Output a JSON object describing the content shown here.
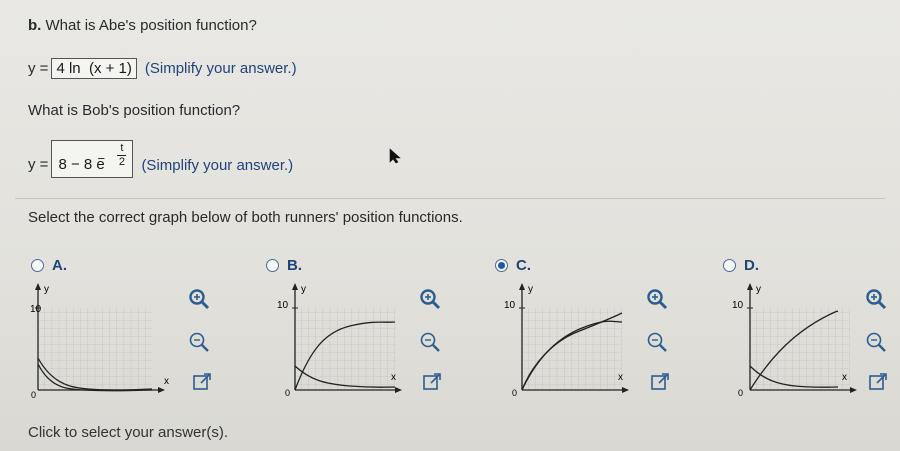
{
  "question_b": {
    "label": "b.",
    "text": "What is Abe's position function?",
    "lhs": "y =",
    "answer": "4 ln  (x + 1)",
    "hint": "(Simplify your answer.)"
  },
  "question_bob": {
    "text": "What is Bob's position function?",
    "lhs": "y =",
    "answer_base": "8 − 8 e",
    "answer_exp_minus": "−",
    "answer_exp_num": "t",
    "answer_exp_den": "2",
    "hint": "(Simplify your answer.)"
  },
  "select_prompt": "Select the correct graph below of both runners' position functions.",
  "options": [
    {
      "label": "A.",
      "selected": false
    },
    {
      "label": "B.",
      "selected": false
    },
    {
      "label": "C.",
      "selected": true
    },
    {
      "label": "D.",
      "selected": false
    }
  ],
  "graph_axis": {
    "y_label": "y",
    "x_label": "x",
    "y_tick": "10",
    "origin": "0"
  },
  "footer": "Click to select your answer(s).",
  "colors": {
    "accent": "#1f56b3",
    "option_text": "#21437a",
    "zoom_icon": "#2d5d8f"
  }
}
